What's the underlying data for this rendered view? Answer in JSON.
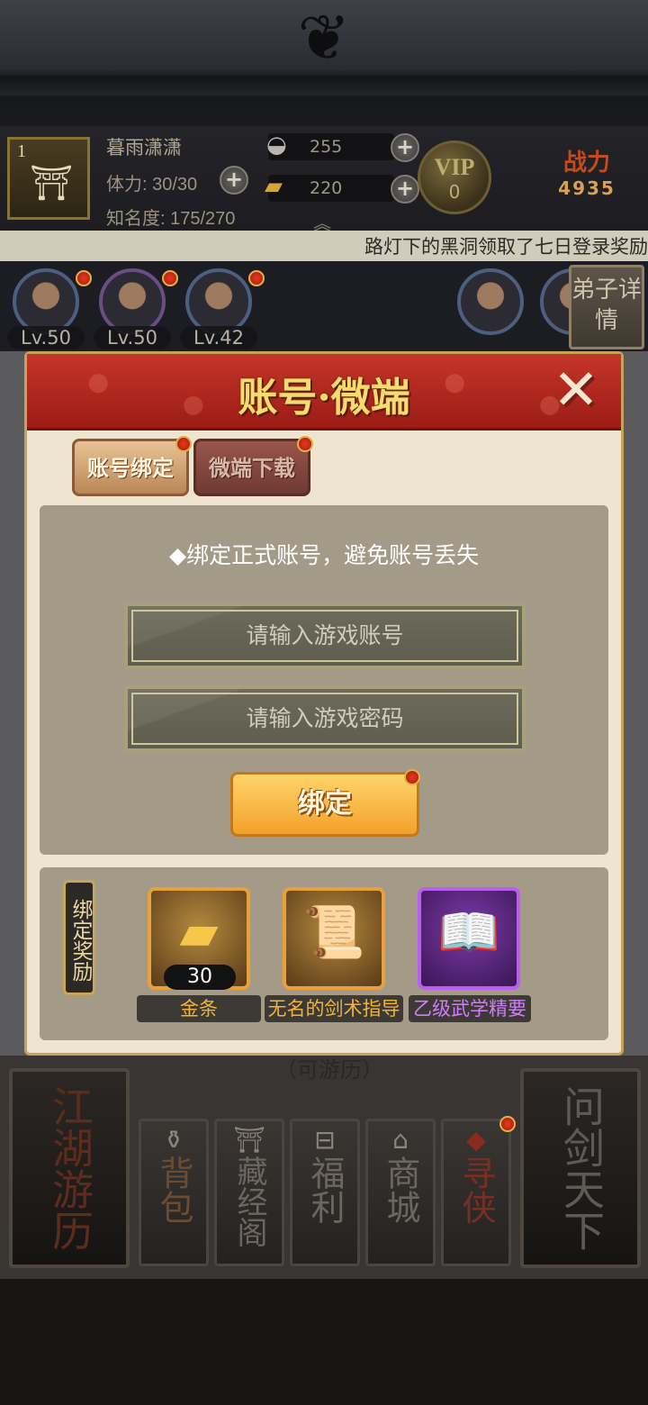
{
  "player": {
    "level": "1",
    "name": "暮雨潇潇",
    "stamina_label": "体力:",
    "stamina_value": "30/30",
    "fame_label": "知名度:",
    "fame_value": "175/270",
    "silver": "255",
    "gold": "220",
    "vip_label": "VIP",
    "vip_level": "0",
    "power_label": "战力",
    "power_value": "4935"
  },
  "marquee": "路灯下的黑洞领取了七日登录奖励",
  "disciples": [
    {
      "level": "Lv.50"
    },
    {
      "level": "Lv.50"
    },
    {
      "level": "Lv.42"
    }
  ],
  "detail_button": "弟子详情",
  "modal": {
    "title": "账号·微端",
    "close_icon": "✕",
    "tabs": [
      {
        "label": "账号绑定"
      },
      {
        "label": "微端下载"
      }
    ],
    "tip": "◆绑定正式账号，避免账号丢失",
    "account_placeholder": "请输入游戏账号",
    "password_placeholder": "请输入游戏密码",
    "bind_button": "绑定",
    "reward_tag": "绑定奖励",
    "rewards": [
      {
        "name": "金条",
        "count": "30",
        "name_color": "#f2b33a"
      },
      {
        "name": "无名的剑术指导",
        "name_color": "#f2b33a"
      },
      {
        "name": "乙级武学精要",
        "name_color": "#d27bff"
      }
    ]
  },
  "behind_text": "（可游历）",
  "nav": {
    "jianghu": "江湖游历",
    "bag": "背包",
    "library": "藏经阁",
    "welfare": "福利",
    "shop": "商城",
    "xunxia": "寻侠",
    "wenjian": "问剑天下"
  }
}
